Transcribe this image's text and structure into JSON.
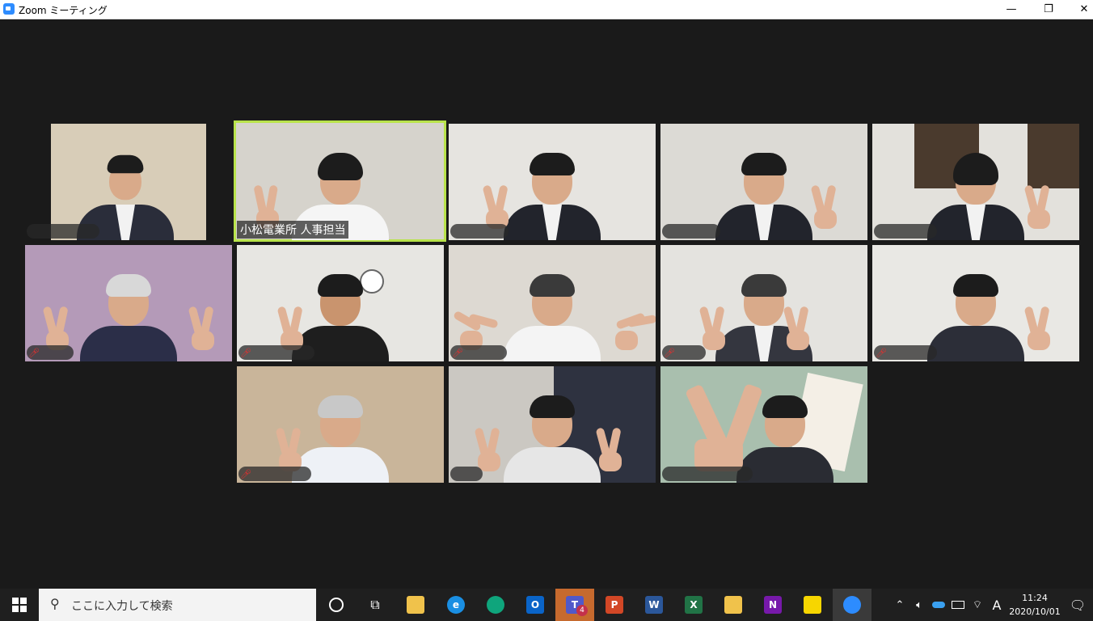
{
  "window": {
    "title": "Zoom ミーティング",
    "minimize": "—",
    "restore": "❐",
    "close": "✕"
  },
  "gallery": {
    "active_speaker_label": "小松電業所 人事担当"
  },
  "taskbar": {
    "search_placeholder": "ここに入力して検索",
    "teams_badge": "4",
    "ime_indicator": "A",
    "time": "11:24",
    "date": "2020/10/01"
  },
  "icons": {
    "start": "windows-logo",
    "search": "magnifier",
    "cortana": "circle",
    "taskview": "task-view",
    "apps": [
      "file-explorer",
      "internet-explorer",
      "edge",
      "outlook",
      "teams",
      "powerpoint",
      "word",
      "excel",
      "file-manager",
      "onenote",
      "sticky-notes",
      "zoom"
    ],
    "tray": [
      "chevron-up",
      "speaker",
      "onedrive",
      "battery",
      "wifi",
      "ime",
      "notifications"
    ]
  },
  "colors": {
    "active_speaker_border": "#b9e34b",
    "zoom_blue": "#2d8cff",
    "mute_red": "#e0302f"
  }
}
